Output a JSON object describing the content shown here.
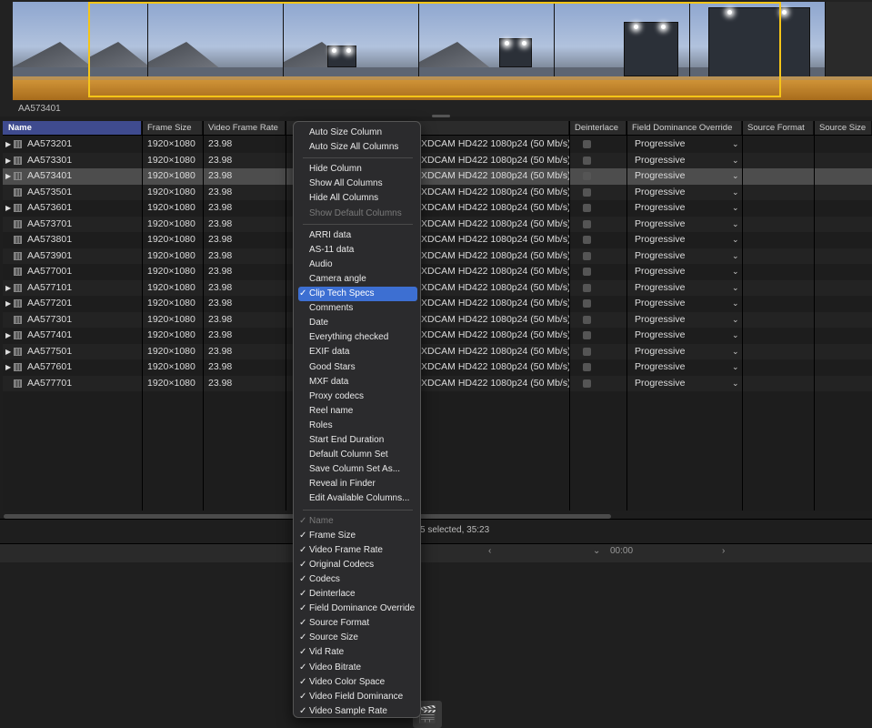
{
  "viewer": {
    "clip_label": "AA573401"
  },
  "columns": [
    {
      "label": "Name",
      "sorted": true
    },
    {
      "label": "Frame Size"
    },
    {
      "label": "Video Frame Rate"
    },
    {
      "label": ""
    },
    {
      "label": "Deinterlace"
    },
    {
      "label": "Field Dominance Override"
    },
    {
      "label": "Source Format"
    },
    {
      "label": "Source Size"
    }
  ],
  "rows": [
    {
      "name": "AA573201",
      "expandable": true,
      "frame_size": "1920×1080",
      "frame_rate": "23.98",
      "codec": "XDCAM HD422 1080p24 (50 Mb/s)",
      "field_dominance": "Progressive"
    },
    {
      "name": "AA573301",
      "expandable": true,
      "frame_size": "1920×1080",
      "frame_rate": "23.98",
      "codec": "XDCAM HD422 1080p24 (50 Mb/s)",
      "field_dominance": "Progressive"
    },
    {
      "name": "AA573401",
      "expandable": true,
      "frame_size": "1920×1080",
      "frame_rate": "23.98",
      "codec": "XDCAM HD422 1080p24 (50 Mb/s)",
      "field_dominance": "Progressive",
      "selected": true
    },
    {
      "name": "AA573501",
      "expandable": false,
      "frame_size": "1920×1080",
      "frame_rate": "23.98",
      "codec": "XDCAM HD422 1080p24 (50 Mb/s)",
      "field_dominance": "Progressive"
    },
    {
      "name": "AA573601",
      "expandable": true,
      "frame_size": "1920×1080",
      "frame_rate": "23.98",
      "codec": "XDCAM HD422 1080p24 (50 Mb/s)",
      "field_dominance": "Progressive"
    },
    {
      "name": "AA573701",
      "expandable": false,
      "frame_size": "1920×1080",
      "frame_rate": "23.98",
      "codec": "XDCAM HD422 1080p24 (50 Mb/s)",
      "field_dominance": "Progressive"
    },
    {
      "name": "AA573801",
      "expandable": false,
      "frame_size": "1920×1080",
      "frame_rate": "23.98",
      "codec": "XDCAM HD422 1080p24 (50 Mb/s)",
      "field_dominance": "Progressive"
    },
    {
      "name": "AA573901",
      "expandable": false,
      "frame_size": "1920×1080",
      "frame_rate": "23.98",
      "codec": "XDCAM HD422 1080p24 (50 Mb/s)",
      "field_dominance": "Progressive"
    },
    {
      "name": "AA577001",
      "expandable": false,
      "frame_size": "1920×1080",
      "frame_rate": "23.98",
      "codec": "XDCAM HD422 1080p24 (50 Mb/s)",
      "field_dominance": "Progressive"
    },
    {
      "name": "AA577101",
      "expandable": true,
      "frame_size": "1920×1080",
      "frame_rate": "23.98",
      "codec": "XDCAM HD422 1080p24 (50 Mb/s)",
      "field_dominance": "Progressive"
    },
    {
      "name": "AA577201",
      "expandable": true,
      "frame_size": "1920×1080",
      "frame_rate": "23.98",
      "codec": "XDCAM HD422 1080p24 (50 Mb/s)",
      "field_dominance": "Progressive"
    },
    {
      "name": "AA577301",
      "expandable": false,
      "frame_size": "1920×1080",
      "frame_rate": "23.98",
      "codec": "XDCAM HD422 1080p24 (50 Mb/s)",
      "field_dominance": "Progressive"
    },
    {
      "name": "AA577401",
      "expandable": true,
      "frame_size": "1920×1080",
      "frame_rate": "23.98",
      "codec": "XDCAM HD422 1080p24 (50 Mb/s)",
      "field_dominance": "Progressive"
    },
    {
      "name": "AA577501",
      "expandable": true,
      "frame_size": "1920×1080",
      "frame_rate": "23.98",
      "codec": "XDCAM HD422 1080p24 (50 Mb/s)",
      "field_dominance": "Progressive"
    },
    {
      "name": "AA577601",
      "expandable": true,
      "frame_size": "1920×1080",
      "frame_rate": "23.98",
      "codec": "XDCAM HD422 1080p24 (50 Mb/s)",
      "field_dominance": "Progressive"
    },
    {
      "name": "AA577701",
      "expandable": false,
      "frame_size": "1920×1080",
      "frame_rate": "23.98",
      "codec": "XDCAM HD422 1080p24 (50 Mb/s)",
      "field_dominance": "Progressive"
    }
  ],
  "status": {
    "text": "5 selected, 35:23"
  },
  "timeline": {
    "timecode": "00:00"
  },
  "context_menu": {
    "groups": [
      [
        {
          "label": "Auto Size Column"
        },
        {
          "label": "Auto Size All Columns"
        }
      ],
      [
        {
          "label": "Hide Column"
        },
        {
          "label": "Show All Columns"
        },
        {
          "label": "Hide All Columns"
        },
        {
          "label": "Show Default Columns",
          "disabled": true
        }
      ],
      [
        {
          "label": "ARRI data"
        },
        {
          "label": "AS-11 data"
        },
        {
          "label": "Audio"
        },
        {
          "label": "Camera angle"
        },
        {
          "label": "Clip Tech Specs",
          "checked": true,
          "highlighted": true
        },
        {
          "label": "Comments"
        },
        {
          "label": "Date"
        },
        {
          "label": "Everything checked"
        },
        {
          "label": "EXIF data"
        },
        {
          "label": "Good Stars"
        },
        {
          "label": "MXF data"
        },
        {
          "label": "Proxy codecs"
        },
        {
          "label": "Reel name"
        },
        {
          "label": "Roles"
        },
        {
          "label": "Start End Duration"
        },
        {
          "label": "Default Column Set"
        },
        {
          "label": "Save Column Set As..."
        },
        {
          "label": "Reveal in Finder"
        },
        {
          "label": "Edit Available Columns..."
        }
      ],
      [
        {
          "label": "Name",
          "checked": true,
          "disabled": true
        },
        {
          "label": "Frame Size",
          "checked": true
        },
        {
          "label": "Video Frame Rate",
          "checked": true
        },
        {
          "label": "Original Codecs",
          "checked": true
        },
        {
          "label": "Codecs",
          "checked": true
        },
        {
          "label": "Deinterlace",
          "checked": true
        },
        {
          "label": "Field Dominance Override",
          "checked": true
        },
        {
          "label": "Source Format",
          "checked": true
        },
        {
          "label": "Source Size",
          "checked": true
        },
        {
          "label": "Vid Rate",
          "checked": true
        },
        {
          "label": "Video Bitrate",
          "checked": true
        },
        {
          "label": "Video Color Space",
          "checked": true
        },
        {
          "label": "Video Field Dominance",
          "checked": true
        },
        {
          "label": "Video Sample Rate",
          "checked": true
        }
      ]
    ]
  },
  "icons": {
    "clip": "film-clip-icon",
    "clapper": "clapperboard-icon",
    "disclosure": "disclosure-triangle-icon"
  },
  "colors": {
    "selection": "#3d6fd2",
    "range_outline": "#f5c518",
    "audio": "#d69a3c",
    "header_selected": "#3f4b8f"
  }
}
